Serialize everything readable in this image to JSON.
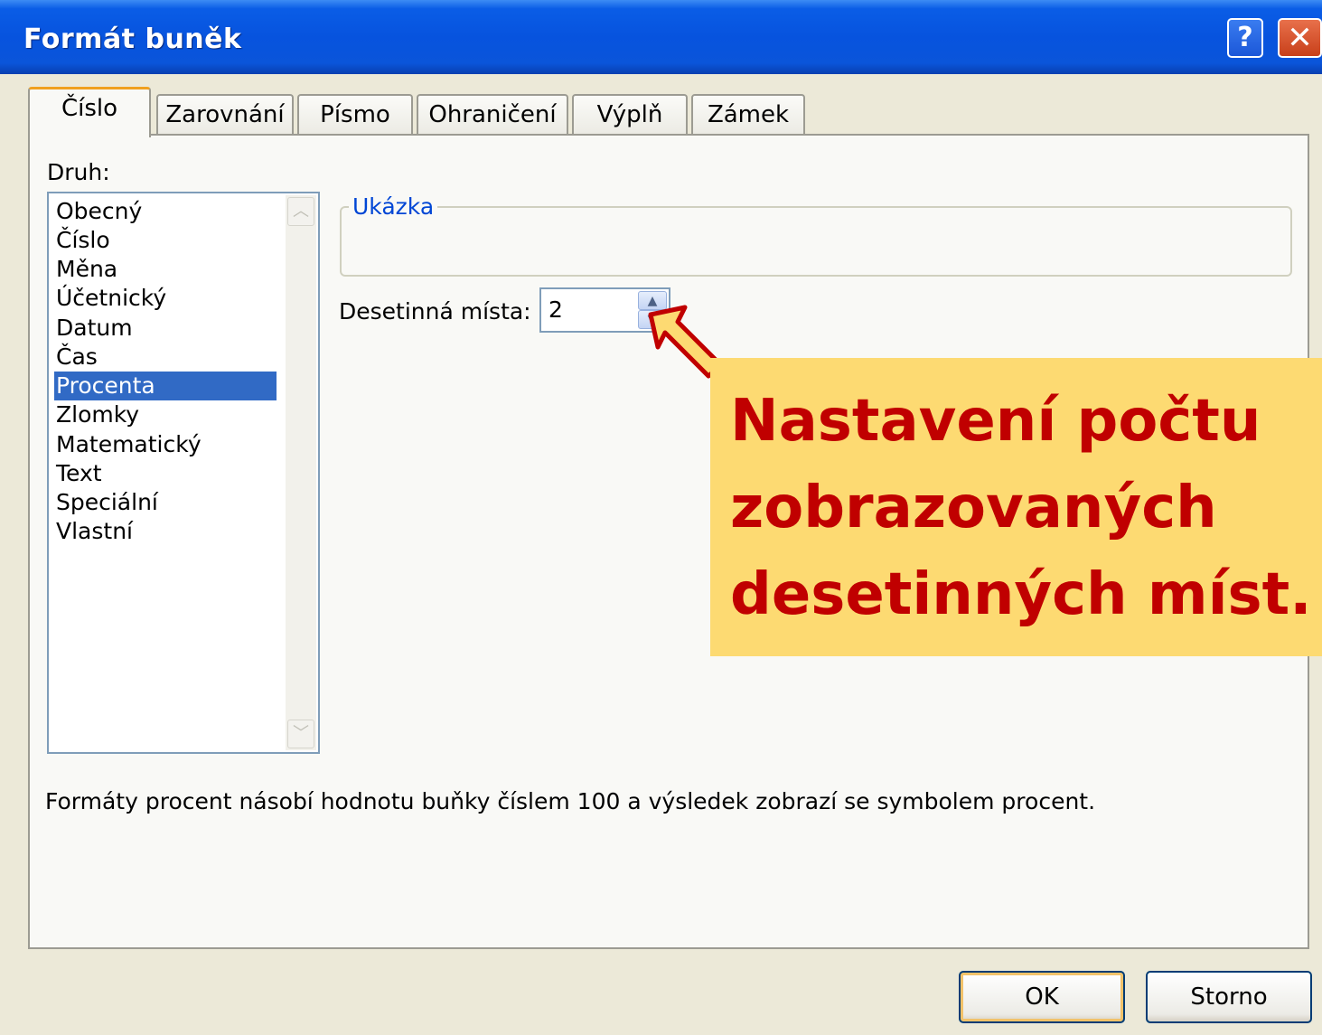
{
  "window": {
    "title": "Formát buněk",
    "help_label": "?",
    "close_label": "✕"
  },
  "tabs": [
    {
      "label": "Číslo",
      "active": true
    },
    {
      "label": "Zarovnání",
      "active": false
    },
    {
      "label": "Písmo",
      "active": false
    },
    {
      "label": "Ohraničení",
      "active": false
    },
    {
      "label": "Výplň",
      "active": false
    },
    {
      "label": "Zámek",
      "active": false
    }
  ],
  "category": {
    "label": "Druh:",
    "items": [
      "Obecný",
      "Číslo",
      "Měna",
      "Účetnický",
      "Datum",
      "Čas",
      "Procenta",
      "Zlomky",
      "Matematický",
      "Text",
      "Speciální",
      "Vlastní"
    ],
    "selected": "Procenta"
  },
  "sample": {
    "title": "Ukázka",
    "value": ""
  },
  "decimal_places": {
    "label": "Desetinná místa:",
    "value": "2"
  },
  "description": "Formáty procent násobí hodnotu buňky číslem 100 a výsledek zobrazí se symbolem procent.",
  "buttons": {
    "ok_label": "OK",
    "cancel_label": "Storno"
  },
  "callout": {
    "lines": [
      "Nastavení počtu",
      "zobrazovaných",
      "desetinných míst."
    ]
  },
  "colors": {
    "callout_background": "#fdda72",
    "callout_text": "#c00000",
    "selection": "#316ac5",
    "titlebar": "#0753de"
  },
  "icons": {
    "scroll_up": "chevron-up-icon",
    "scroll_down": "chevron-down-icon",
    "spin_up": "triangle-up-icon",
    "spin_down": "triangle-down-icon",
    "callout_arrow": "arrow-up-left-icon"
  }
}
